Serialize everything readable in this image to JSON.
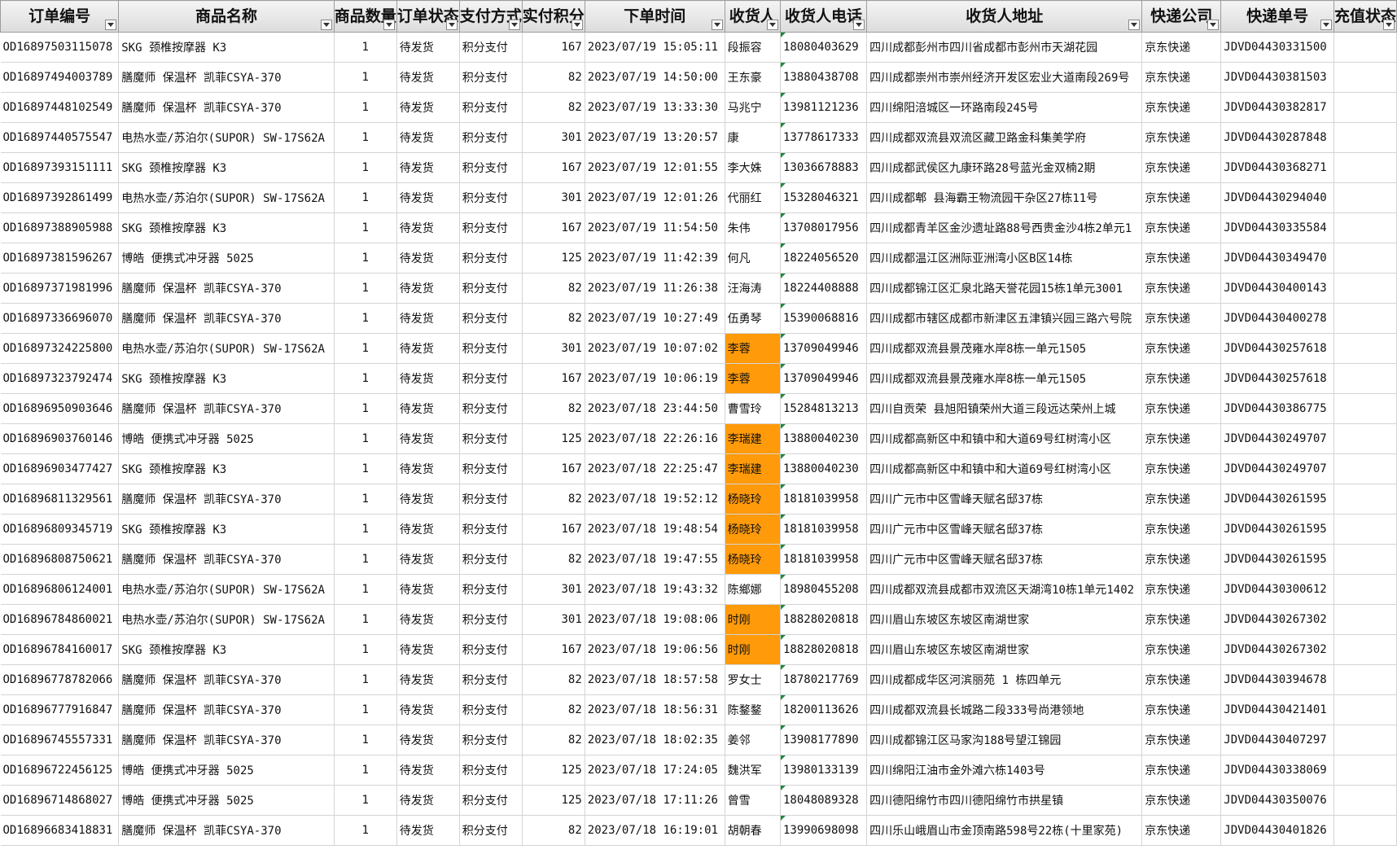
{
  "headers": [
    {
      "label": "订单编号",
      "key": "order_id",
      "align": "left"
    },
    {
      "label": "商品名称",
      "key": "product",
      "align": "left"
    },
    {
      "label": "商品数量",
      "key": "qty",
      "align": "center"
    },
    {
      "label": "订单状态",
      "key": "status",
      "align": "left"
    },
    {
      "label": "支付方式",
      "key": "payment",
      "align": "left"
    },
    {
      "label": "实付积分",
      "key": "points",
      "align": "right"
    },
    {
      "label": "下单时间",
      "key": "time",
      "align": "left"
    },
    {
      "label": "收货人",
      "key": "recipient",
      "align": "left"
    },
    {
      "label": "收货人电话",
      "key": "phone",
      "align": "left"
    },
    {
      "label": "收货人地址",
      "key": "address",
      "align": "left"
    },
    {
      "label": "快递公司",
      "key": "courier",
      "align": "left"
    },
    {
      "label": "快递单号",
      "key": "tracking",
      "align": "left"
    },
    {
      "label": "充值状态",
      "key": "recharge",
      "align": "left"
    }
  ],
  "highlight_color": "#ff9a0a",
  "rows": [
    {
      "order_id": "OD16897503115078",
      "product": "SKG 颈椎按摩器 K3",
      "qty": "1",
      "status": "待发货",
      "payment": "积分支付",
      "points": "167",
      "time": "2023/07/19 15:05:11",
      "recipient": "段振容",
      "phone": "18080403629",
      "address": "四川成都彭州市四川省成都市彭州市天湖花园",
      "courier": "京东快递",
      "tracking": "JDVD04430331500",
      "recharge": "",
      "highlight": false
    },
    {
      "order_id": "OD16897494003789",
      "product": "膳魔师 保温杯 凯菲CSYA-370",
      "qty": "1",
      "status": "待发货",
      "payment": "积分支付",
      "points": "82",
      "time": "2023/07/19 14:50:00",
      "recipient": "王东豪",
      "phone": "13880438708",
      "address": "四川成都崇州市崇州经济开发区宏业大道南段269号",
      "courier": "京东快递",
      "tracking": "JDVD04430381503",
      "recharge": "",
      "highlight": false
    },
    {
      "order_id": "OD16897448102549",
      "product": "膳魔师 保温杯 凯菲CSYA-370",
      "qty": "1",
      "status": "待发货",
      "payment": "积分支付",
      "points": "82",
      "time": "2023/07/19 13:33:30",
      "recipient": "马兆宁",
      "phone": "13981121236",
      "address": "四川绵阳涪城区一环路南段245号",
      "courier": "京东快递",
      "tracking": "JDVD04430382817",
      "recharge": "",
      "highlight": false
    },
    {
      "order_id": "OD16897440575547",
      "product": "电热水壶/苏泊尔(SUPOR) SW-17S62A",
      "qty": "1",
      "status": "待发货",
      "payment": "积分支付",
      "points": "301",
      "time": "2023/07/19 13:20:57",
      "recipient": "康",
      "phone": "13778617333",
      "address": "四川成都双流县双流区藏卫路金科集美学府",
      "courier": "京东快递",
      "tracking": "JDVD04430287848",
      "recharge": "",
      "highlight": false
    },
    {
      "order_id": "OD16897393151111",
      "product": "SKG 颈椎按摩器 K3",
      "qty": "1",
      "status": "待发货",
      "payment": "积分支付",
      "points": "167",
      "time": "2023/07/19 12:01:55",
      "recipient": "李大姝",
      "phone": "13036678883",
      "address": "四川成都武侯区九康环路28号蓝光金双楠2期",
      "courier": "京东快递",
      "tracking": "JDVD04430368271",
      "recharge": "",
      "highlight": false
    },
    {
      "order_id": "OD16897392861499",
      "product": "电热水壶/苏泊尔(SUPOR) SW-17S62A",
      "qty": "1",
      "status": "待发货",
      "payment": "积分支付",
      "points": "301",
      "time": "2023/07/19 12:01:26",
      "recipient": "代丽红",
      "phone": "15328046321",
      "address": "四川成都郫 县海霸王物流园干杂区27栋11号",
      "courier": "京东快递",
      "tracking": "JDVD04430294040",
      "recharge": "",
      "highlight": false
    },
    {
      "order_id": "OD16897388905988",
      "product": "SKG 颈椎按摩器 K3",
      "qty": "1",
      "status": "待发货",
      "payment": "积分支付",
      "points": "167",
      "time": "2023/07/19 11:54:50",
      "recipient": "朱伟",
      "phone": "13708017956",
      "address": "四川成都青羊区金沙遗址路88号西贵金沙4栋2单元1",
      "courier": "京东快递",
      "tracking": "JDVD04430335584",
      "recharge": "",
      "highlight": false
    },
    {
      "order_id": "OD16897381596267",
      "product": "博皓 便携式冲牙器 5025",
      "qty": "1",
      "status": "待发货",
      "payment": "积分支付",
      "points": "125",
      "time": "2023/07/19 11:42:39",
      "recipient": "何凡",
      "phone": "18224056520",
      "address": "四川成都温江区洲际亚洲湾小区B区14栋",
      "courier": "京东快递",
      "tracking": "JDVD04430349470",
      "recharge": "",
      "highlight": false
    },
    {
      "order_id": "OD16897371981996",
      "product": "膳魔师 保温杯 凯菲CSYA-370",
      "qty": "1",
      "status": "待发货",
      "payment": "积分支付",
      "points": "82",
      "time": "2023/07/19 11:26:38",
      "recipient": "汪海涛",
      "phone": "18224408888",
      "address": "四川成都锦江区汇泉北路天誉花园15栋1单元3001",
      "courier": "京东快递",
      "tracking": "JDVD04430400143",
      "recharge": "",
      "highlight": false
    },
    {
      "order_id": "OD16897336696070",
      "product": "膳魔师 保温杯 凯菲CSYA-370",
      "qty": "1",
      "status": "待发货",
      "payment": "积分支付",
      "points": "82",
      "time": "2023/07/19 10:27:49",
      "recipient": "伍勇琴",
      "phone": "15390068816",
      "address": "四川成都市辖区成都市新津区五津镇兴园三路六号院",
      "courier": "京东快递",
      "tracking": "JDVD04430400278",
      "recharge": "",
      "highlight": false
    },
    {
      "order_id": "OD16897324225800",
      "product": "电热水壶/苏泊尔(SUPOR) SW-17S62A",
      "qty": "1",
      "status": "待发货",
      "payment": "积分支付",
      "points": "301",
      "time": "2023/07/19 10:07:02",
      "recipient": "李蓉",
      "phone": "13709049946",
      "address": "四川成都双流县景茂雍水岸8栋一单元1505",
      "courier": "京东快递",
      "tracking": "JDVD04430257618",
      "recharge": "",
      "highlight": true
    },
    {
      "order_id": "OD16897323792474",
      "product": "SKG 颈椎按摩器 K3",
      "qty": "1",
      "status": "待发货",
      "payment": "积分支付",
      "points": "167",
      "time": "2023/07/19 10:06:19",
      "recipient": "李蓉",
      "phone": "13709049946",
      "address": "四川成都双流县景茂雍水岸8栋一单元1505",
      "courier": "京东快递",
      "tracking": "JDVD04430257618",
      "recharge": "",
      "highlight": true
    },
    {
      "order_id": "OD16896950903646",
      "product": "膳魔师 保温杯 凯菲CSYA-370",
      "qty": "1",
      "status": "待发货",
      "payment": "积分支付",
      "points": "82",
      "time": "2023/07/18 23:44:50",
      "recipient": "曹雪玲",
      "phone": "15284813213",
      "address": "四川自贡荣 县旭阳镇荣州大道三段远达荣州上城",
      "courier": "京东快递",
      "tracking": "JDVD04430386775",
      "recharge": "",
      "highlight": false
    },
    {
      "order_id": "OD16896903760146",
      "product": "博皓 便携式冲牙器 5025",
      "qty": "1",
      "status": "待发货",
      "payment": "积分支付",
      "points": "125",
      "time": "2023/07/18 22:26:16",
      "recipient": "李瑞建",
      "phone": "13880040230",
      "address": "四川成都高新区中和镇中和大道69号红树湾小区",
      "courier": "京东快递",
      "tracking": "JDVD04430249707",
      "recharge": "",
      "highlight": true
    },
    {
      "order_id": "OD16896903477427",
      "product": "SKG 颈椎按摩器 K3",
      "qty": "1",
      "status": "待发货",
      "payment": "积分支付",
      "points": "167",
      "time": "2023/07/18 22:25:47",
      "recipient": "李瑞建",
      "phone": "13880040230",
      "address": "四川成都高新区中和镇中和大道69号红树湾小区",
      "courier": "京东快递",
      "tracking": "JDVD04430249707",
      "recharge": "",
      "highlight": true
    },
    {
      "order_id": "OD16896811329561",
      "product": "膳魔师 保温杯 凯菲CSYA-370",
      "qty": "1",
      "status": "待发货",
      "payment": "积分支付",
      "points": "82",
      "time": "2023/07/18 19:52:12",
      "recipient": "杨晓玲",
      "phone": "18181039958",
      "address": "四川广元市中区雪峰天赋名邸37栋",
      "courier": "京东快递",
      "tracking": "JDVD04430261595",
      "recharge": "",
      "highlight": true
    },
    {
      "order_id": "OD16896809345719",
      "product": "SKG 颈椎按摩器 K3",
      "qty": "1",
      "status": "待发货",
      "payment": "积分支付",
      "points": "167",
      "time": "2023/07/18 19:48:54",
      "recipient": "杨晓玲",
      "phone": "18181039958",
      "address": "四川广元市中区雪峰天赋名邸37栋",
      "courier": "京东快递",
      "tracking": "JDVD04430261595",
      "recharge": "",
      "highlight": true
    },
    {
      "order_id": "OD16896808750621",
      "product": "膳魔师 保温杯 凯菲CSYA-370",
      "qty": "1",
      "status": "待发货",
      "payment": "积分支付",
      "points": "82",
      "time": "2023/07/18 19:47:55",
      "recipient": "杨晓玲",
      "phone": "18181039958",
      "address": "四川广元市中区雪峰天赋名邸37栋",
      "courier": "京东快递",
      "tracking": "JDVD04430261595",
      "recharge": "",
      "highlight": true
    },
    {
      "order_id": "OD16896806124001",
      "product": "电热水壶/苏泊尔(SUPOR) SW-17S62A",
      "qty": "1",
      "status": "待发货",
      "payment": "积分支付",
      "points": "301",
      "time": "2023/07/18 19:43:32",
      "recipient": "陈鄉娜",
      "phone": "18980455208",
      "address": "四川成都双流县成都市双流区天湖湾10栋1单元1402",
      "courier": "京东快递",
      "tracking": "JDVD04430300612",
      "recharge": "",
      "highlight": false
    },
    {
      "order_id": "OD16896784860021",
      "product": "电热水壶/苏泊尔(SUPOR) SW-17S62A",
      "qty": "1",
      "status": "待发货",
      "payment": "积分支付",
      "points": "301",
      "time": "2023/07/18 19:08:06",
      "recipient": "时刚",
      "phone": "18828020818",
      "address": "四川眉山东坡区东坡区南湖世家",
      "courier": "京东快递",
      "tracking": "JDVD04430267302",
      "recharge": "",
      "highlight": true
    },
    {
      "order_id": "OD16896784160017",
      "product": "SKG 颈椎按摩器 K3",
      "qty": "1",
      "status": "待发货",
      "payment": "积分支付",
      "points": "167",
      "time": "2023/07/18 19:06:56",
      "recipient": "时刚",
      "phone": "18828020818",
      "address": "四川眉山东坡区东坡区南湖世家",
      "courier": "京东快递",
      "tracking": "JDVD04430267302",
      "recharge": "",
      "highlight": true
    },
    {
      "order_id": "OD16896778782066",
      "product": "膳魔师 保温杯 凯菲CSYA-370",
      "qty": "1",
      "status": "待发货",
      "payment": "积分支付",
      "points": "82",
      "time": "2023/07/18 18:57:58",
      "recipient": "罗女士",
      "phone": "18780217769",
      "address": "四川成都成华区河滨丽苑 1 栋四单元",
      "courier": "京东快递",
      "tracking": "JDVD04430394678",
      "recharge": "",
      "highlight": false
    },
    {
      "order_id": "OD16896777916847",
      "product": "膳魔师 保温杯 凯菲CSYA-370",
      "qty": "1",
      "status": "待发货",
      "payment": "积分支付",
      "points": "82",
      "time": "2023/07/18 18:56:31",
      "recipient": "陈鍪鍪",
      "phone": "18200113626",
      "address": "四川成都双流县长城路二段333号尚港领地",
      "courier": "京东快递",
      "tracking": "JDVD04430421401",
      "recharge": "",
      "highlight": false
    },
    {
      "order_id": "OD16896745557331",
      "product": "膳魔师 保温杯 凯菲CSYA-370",
      "qty": "1",
      "status": "待发货",
      "payment": "积分支付",
      "points": "82",
      "time": "2023/07/18 18:02:35",
      "recipient": "姜邻",
      "phone": "13908177890",
      "address": "四川成都锦江区马家沟188号望江锦园",
      "courier": "京东快递",
      "tracking": "JDVD04430407297",
      "recharge": "",
      "highlight": false
    },
    {
      "order_id": "OD16896722456125",
      "product": "博皓 便携式冲牙器 5025",
      "qty": "1",
      "status": "待发货",
      "payment": "积分支付",
      "points": "125",
      "time": "2023/07/18 17:24:05",
      "recipient": "魏洪军",
      "phone": "13980133139",
      "address": "四川绵阳江油市金外滩六栋1403号",
      "courier": "京东快递",
      "tracking": "JDVD04430338069",
      "recharge": "",
      "highlight": false
    },
    {
      "order_id": "OD16896714868027",
      "product": "博皓 便携式冲牙器 5025",
      "qty": "1",
      "status": "待发货",
      "payment": "积分支付",
      "points": "125",
      "time": "2023/07/18 17:11:26",
      "recipient": "曾雪",
      "phone": "18048089328",
      "address": "四川德阳绵竹市四川德阳绵竹市拱星镇",
      "courier": "京东快递",
      "tracking": "JDVD04430350076",
      "recharge": "",
      "highlight": false
    },
    {
      "order_id": "OD16896683418831",
      "product": "膳魔师 保温杯 凯菲CSYA-370",
      "qty": "1",
      "status": "待发货",
      "payment": "积分支付",
      "points": "82",
      "time": "2023/07/18 16:19:01",
      "recipient": "胡朝春",
      "phone": "13990698098",
      "address": "四川乐山峨眉山市金顶南路598号22栋(十里家苑)",
      "courier": "京东快递",
      "tracking": "JDVD04430401826",
      "recharge": "",
      "highlight": false
    }
  ]
}
